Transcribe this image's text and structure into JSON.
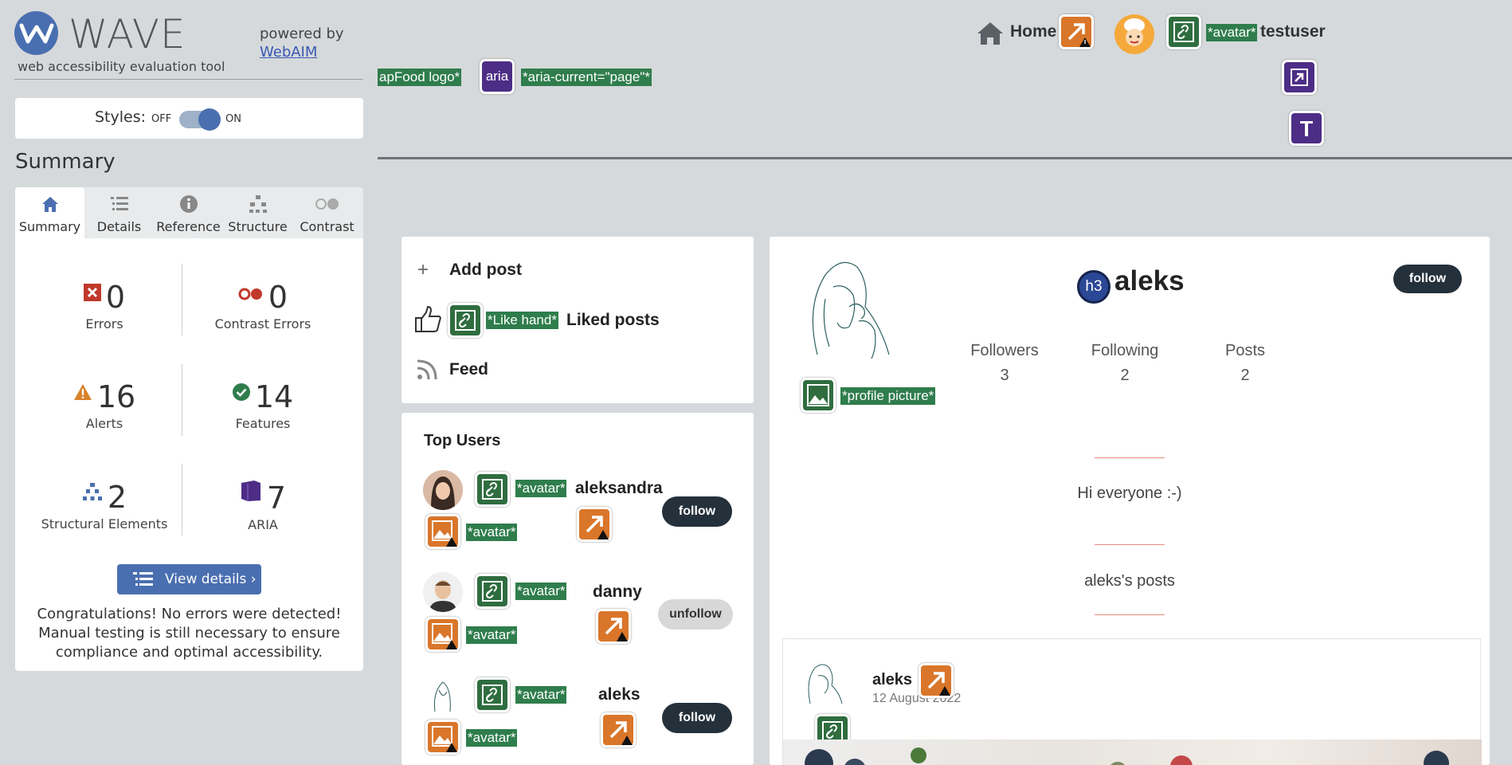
{
  "wave": {
    "title": "WAVE",
    "subtitle": "web accessibility evaluation tool",
    "powered_by": "powered by",
    "webaim_link": "WebAIM",
    "styles_label": "Styles:",
    "styles_off": "OFF",
    "styles_on": "ON",
    "summary_heading": "Summary",
    "tabs": [
      {
        "label": "Summary",
        "icon": "home-icon"
      },
      {
        "label": "Details",
        "icon": "list-icon"
      },
      {
        "label": "Reference",
        "icon": "info-icon"
      },
      {
        "label": "Structure",
        "icon": "hierarchy-icon"
      },
      {
        "label": "Contrast",
        "icon": "contrast-icon"
      }
    ],
    "stats": {
      "errors": {
        "value": "0",
        "label": "Errors"
      },
      "contrast_errors": {
        "value": "0",
        "label": "Contrast Errors"
      },
      "alerts": {
        "value": "16",
        "label": "Alerts"
      },
      "features": {
        "value": "14",
        "label": "Features"
      },
      "structural": {
        "value": "2",
        "label": "Structural Elements"
      },
      "aria": {
        "value": "7",
        "label": "ARIA"
      }
    },
    "view_details": "View details ›",
    "congrats": "Congratulations! No errors were detected! Manual testing is still necessary to ensure compliance and optimal accessibility.",
    "colors": {
      "accent": "#4a6fb0",
      "error": "#c0392b",
      "alert": "#d9822b",
      "feature": "#2f7d4c",
      "aria": "#4d2d86"
    }
  },
  "site": {
    "header": {
      "logo_tag": "apFood logo*",
      "aria_label": "aria",
      "aria_current_tag": "*aria-current=\"page\"*",
      "home": "Home",
      "avatar_tag": "*avatar*",
      "username": "testuser"
    },
    "menu": {
      "add_post": "Add post",
      "like_hand_tag": "*Like hand*",
      "liked_posts": "Liked posts",
      "feed": "Feed"
    },
    "top_users": {
      "title": "Top Users",
      "avatar_tag": "*avatar*",
      "users": [
        {
          "name": "aleksandra",
          "action": "follow"
        },
        {
          "name": "danny",
          "action": "unfollow"
        },
        {
          "name": "aleks",
          "action": "follow"
        }
      ]
    },
    "profile": {
      "name": "aleks",
      "heading_tag": "h3",
      "follow": "follow",
      "profile_picture_tag": "*profile picture*",
      "followers_label": "Followers",
      "followers": "3",
      "following_label": "Following",
      "following": "2",
      "posts_label": "Posts",
      "posts": "2",
      "bio": "Hi everyone :-)",
      "posts_heading": "aleks's posts",
      "post": {
        "author": "aleks",
        "date": "12 August 2022"
      }
    }
  }
}
